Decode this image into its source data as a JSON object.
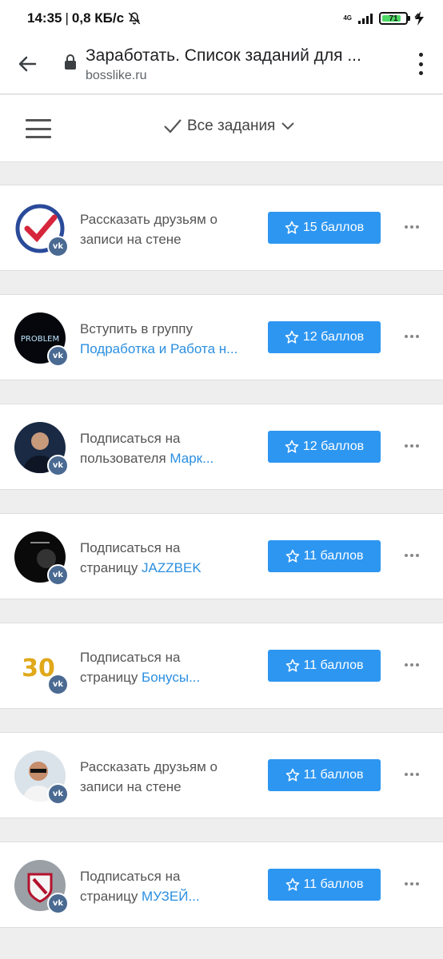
{
  "status_bar": {
    "time": "14:35",
    "speed": "0,8 КБ/с",
    "network": "4G",
    "battery": "71",
    "battery_level": 0.71
  },
  "address_bar": {
    "title": "Заработать. Список заданий для ...",
    "host": "bosslike.ru"
  },
  "site_header": {
    "filter_label": "Все задания"
  },
  "tasks": [
    {
      "line1": "Рассказать друзьям о",
      "line2_text": "записи на стене",
      "line2_link": "",
      "points": "15 баллов",
      "avatar": "checkmark-logo"
    },
    {
      "line1": "Вступить в группу",
      "line2_text": "",
      "line2_link": "Подработка и Работа н...",
      "points": "12 баллов",
      "avatar": "no-problem-neon"
    },
    {
      "line1": "Подписаться на",
      "line2_text": "пользователя ",
      "line2_link": "Марк...",
      "points": "12 баллов",
      "avatar": "man-portrait"
    },
    {
      "line1": "Подписаться на",
      "line2_text": "страницу ",
      "line2_link": "JAZZBEK",
      "points": "11 баллов",
      "avatar": "jazz-dark"
    },
    {
      "line1": "Подписаться на",
      "line2_text": "страницу ",
      "line2_link": "Бонусы...",
      "points": "11 баллов",
      "avatar": "gold-30"
    },
    {
      "line1": "Рассказать друзьям о",
      "line2_text": "записи на стене",
      "line2_link": "",
      "points": "11 баллов",
      "avatar": "man-sunglasses"
    },
    {
      "line1": "Подписаться на",
      "line2_text": "страницу ",
      "line2_link": "МУЗЕЙ...",
      "points": "11 баллов",
      "avatar": "crest-logo"
    }
  ],
  "colors": {
    "button": "#2d96f1",
    "link": "#2b8fe0",
    "vk_badge": "#4a6a92"
  }
}
